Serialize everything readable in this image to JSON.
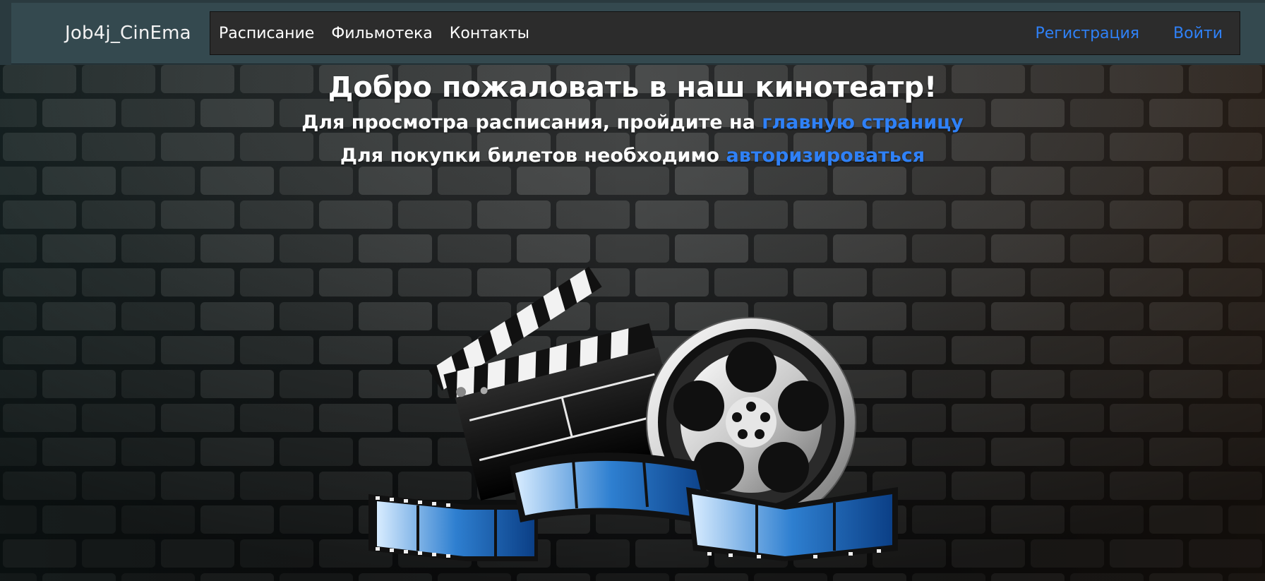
{
  "navbar": {
    "brand": "Job4j_CinEma",
    "left_links": [
      "Расписание",
      "Фильмотека",
      "Контакты"
    ],
    "right_links": [
      "Регистрация",
      "Войти"
    ],
    "colors": {
      "bar": "#34494f",
      "panel": "#2c2c2c",
      "link_accent": "#2f81f7"
    }
  },
  "hero": {
    "title": "Добро пожаловать в наш кинотеатр!",
    "line1_prefix": "Для просмотра расписания, пройдите на ",
    "line1_link": "главную страницу",
    "line2_prefix": "Для покупки билетов необходимо ",
    "line2_link": "авторизироваться"
  },
  "illustration": {
    "icons": [
      "clapperboard-icon",
      "film-reel-icon",
      "film-strip-icon"
    ]
  }
}
